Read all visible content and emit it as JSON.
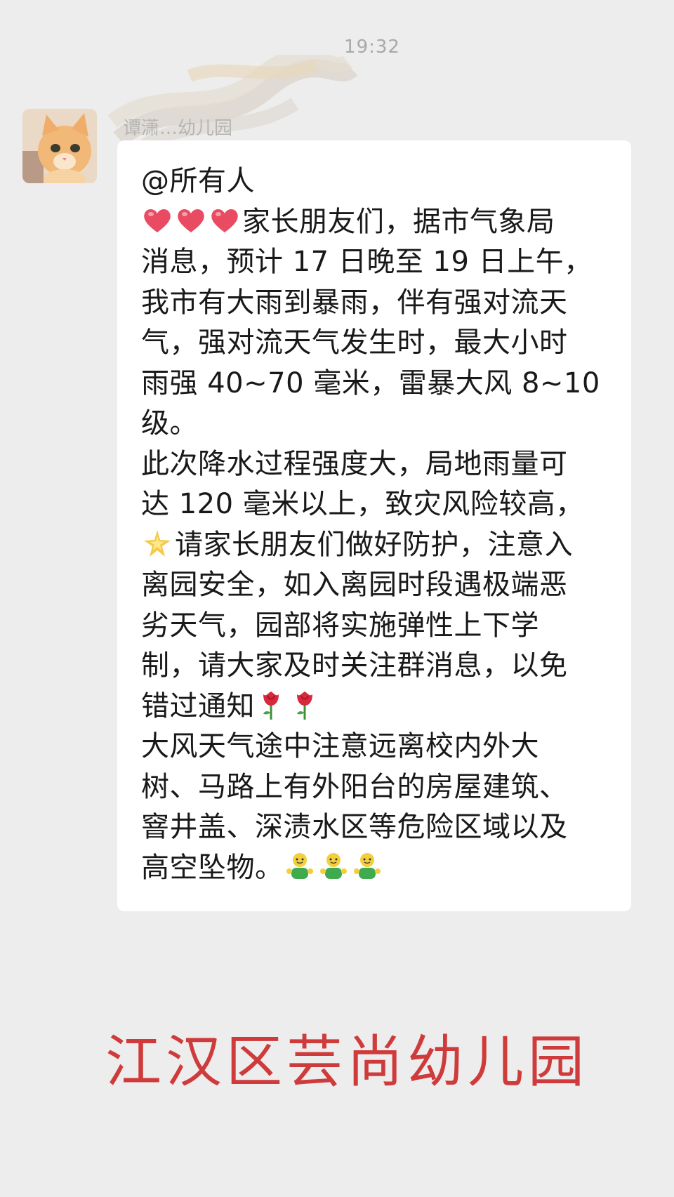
{
  "chat": {
    "timestamp": "19:32",
    "sender_name": "谭潇…幼儿园"
  },
  "message": {
    "mention": "@所有人",
    "line_2": "家长朋友们，据市气象局",
    "line_3": "消息，预计 17 日晚至 19 日上午，",
    "line_4": "我市有大雨到暴雨，伴有强对流天",
    "line_5": "气，强对流天气发生时，最大小时",
    "line_6": "雨强 40~70 毫米，雷暴大风 8~10",
    "line_7": "级。",
    "line_8": "此次降水过程强度大，局地雨量可",
    "line_9": "达 120 毫米以上，致灾风险较高，",
    "line_10": "请家长朋友们做好防护，注意入",
    "line_11": "离园安全，如入离园时段遇极端恶",
    "line_12": "劣天气，园部将实施弹性上下学",
    "line_13": "制，请大家及时关注群消息，以免",
    "line_14": "错过通知",
    "line_15": "大风天气途中注意远离校内外大",
    "line_16": "树、马路上有外阳台的房屋建筑、",
    "line_17": "窨井盖、深渍水区等危险区域以及",
    "line_18": "高空坠物。"
  },
  "icons": {
    "avatar": "cat-avatar",
    "heart": "heart-emoji",
    "sparkle": "sparkle-emoji",
    "rose": "rose-emoji",
    "person": "waving-person-emoji"
  },
  "watermark": {
    "text": "江汉区芸尚幼儿园",
    "color": "#cf3b3b"
  }
}
